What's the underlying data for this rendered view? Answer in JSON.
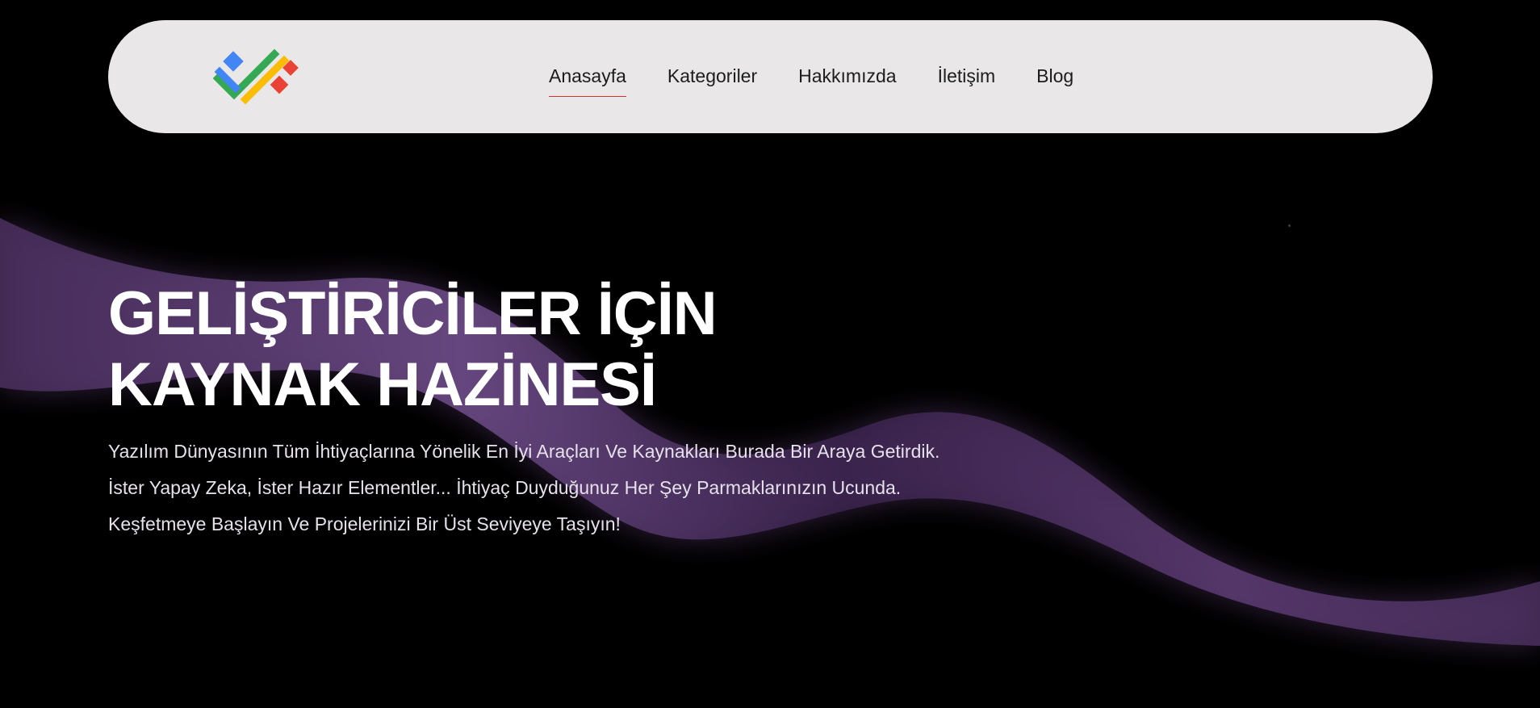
{
  "colors": {
    "background": "#000000",
    "navbar_bg": "#e9e7e7",
    "nav_text": "#1c1c1c",
    "active_underline": "#d9322e",
    "wave": "#5a3a70",
    "logo_blue": "#4285f4",
    "logo_green": "#34a853",
    "logo_yellow": "#fbbc05",
    "logo_red": "#ea4335"
  },
  "logo": {
    "icon": "check-tags-logo-icon"
  },
  "nav": {
    "items": [
      {
        "label": "Anasayfa",
        "active": true
      },
      {
        "label": "Kategoriler",
        "active": false
      },
      {
        "label": "Hakkımızda",
        "active": false
      },
      {
        "label": "İletişim",
        "active": false
      },
      {
        "label": "Blog",
        "active": false
      }
    ]
  },
  "hero": {
    "title_line1": "GELİŞTİRİCİLER İÇİN",
    "title_line2": "KAYNAK HAZİNESİ",
    "text_line1": "Yazılım Dünyasının Tüm İhtiyaçlarına Yönelik En İyi Araçları Ve Kaynakları Burada Bir Araya Getirdik.",
    "text_line2": "İster Yapay Zeka, İster Hazır Elementler... İhtiyaç Duyduğunuz Her Şey Parmaklarınızın Ucunda.",
    "text_line3": "Keşfetmeye Başlayın Ve Projelerinizi Bir Üst Seviyeye Taşıyın!"
  }
}
